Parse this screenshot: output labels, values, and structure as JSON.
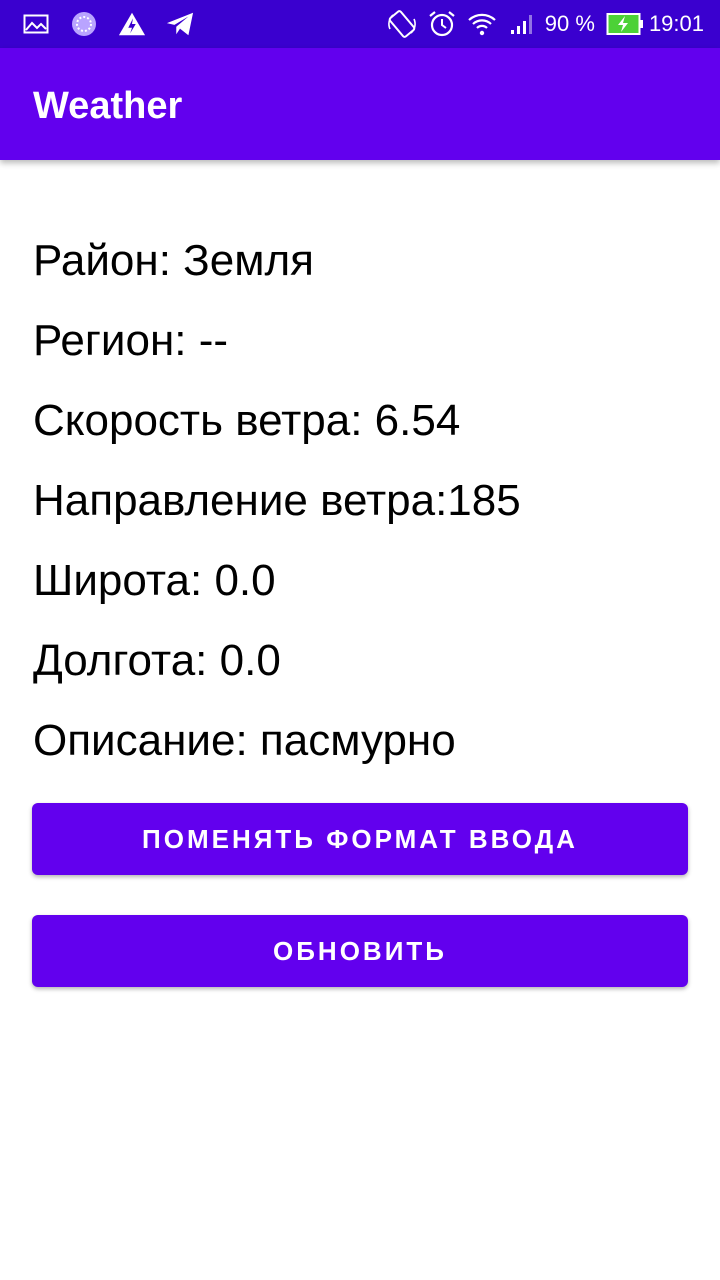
{
  "status_bar": {
    "battery_percent": "90 %",
    "time": "19:01",
    "icons_left": [
      "gallery-icon",
      "loading-circle-icon",
      "flash-app-icon",
      "telegram-icon"
    ],
    "icons_right": [
      "auto-rotate-icon",
      "alarm-clock-icon",
      "wifi-icon",
      "signal-icon",
      "battery-charging-icon"
    ]
  },
  "app_bar": {
    "title": "Weather"
  },
  "weather": {
    "district": "Район: Земля",
    "region": "Регион: --",
    "wind_speed": "Скорость ветра: 6.54",
    "wind_direction": "Направление ветра:185",
    "latitude": "Широта: 0.0",
    "longitude": "Долгота: 0.0",
    "description": "Описание: пасмурно"
  },
  "buttons": {
    "change_format": "ПОМЕНЯТЬ ФОРМАТ ВВОДА",
    "refresh": "ОБНОВИТЬ"
  },
  "colors": {
    "status_bar": "#3a00cf",
    "primary": "#6200ee",
    "battery_fill": "#4cd137"
  }
}
